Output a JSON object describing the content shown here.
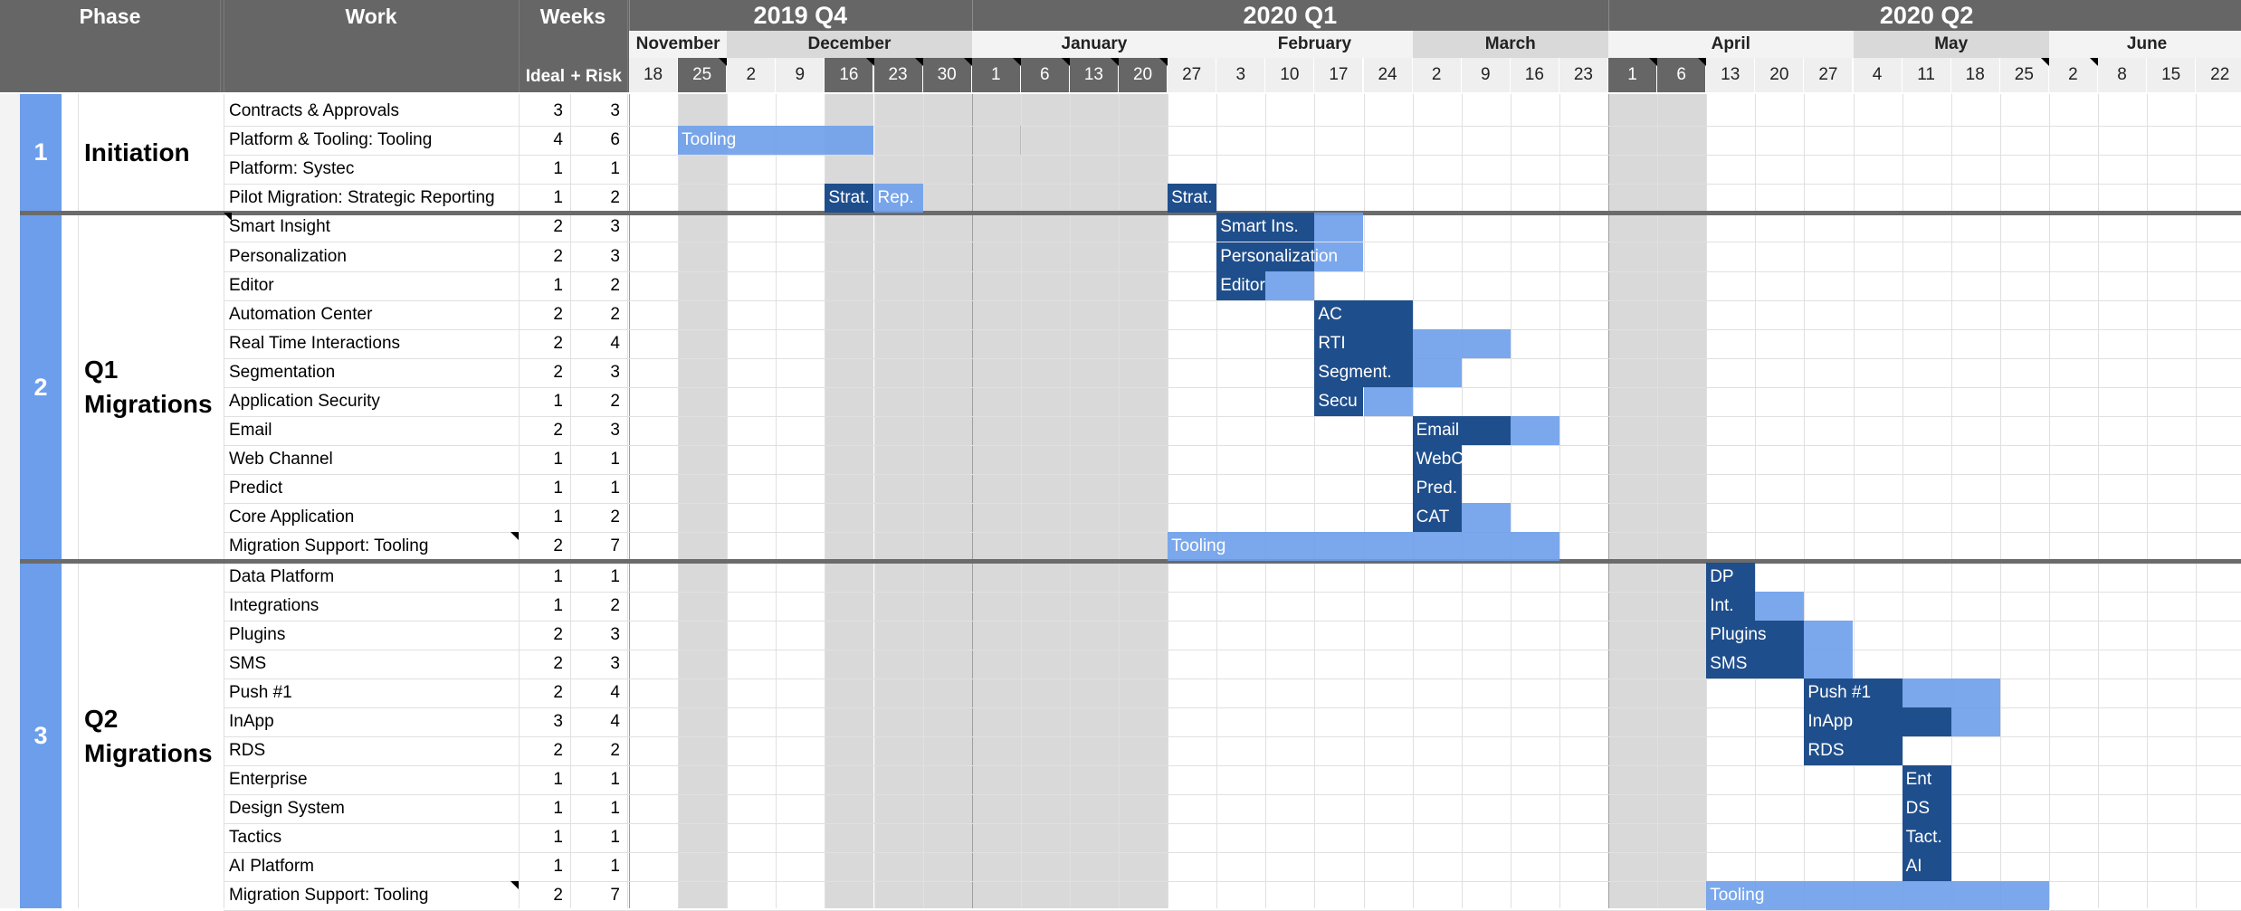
{
  "headers": {
    "phase": "Phase",
    "work": "Work",
    "weeks": "Weeks",
    "ideal": "Ideal",
    "risk": "+ Risk"
  },
  "quarters": [
    "2019 Q4",
    "2020 Q1",
    "2020 Q2"
  ],
  "months": [
    "November",
    "December",
    "January",
    "February",
    "March",
    "April",
    "May",
    "June"
  ],
  "weeks": [
    "18",
    "25",
    "2",
    "9",
    "16",
    "23",
    "30",
    "1",
    "6",
    "13",
    "20",
    "27",
    "3",
    "10",
    "17",
    "24",
    "2",
    "9",
    "16",
    "23",
    "1",
    "6",
    "13",
    "20",
    "27",
    "4",
    "11",
    "18",
    "25",
    "2",
    "8",
    "15",
    "22"
  ],
  "highlighted_weeks": [
    "25",
    "16",
    "23",
    "30",
    "1",
    "6",
    "13",
    "20",
    "1",
    "6"
  ],
  "phases": [
    {
      "number": "1",
      "name": "Initiation"
    },
    {
      "number": "2",
      "name": "Q1\nMigrations"
    },
    {
      "number": "3",
      "name": "Q2\nMigrations"
    }
  ],
  "rows": [
    {
      "work": "Contracts & Approvals",
      "ideal": "3",
      "risk": "3"
    },
    {
      "work": "Platform & Tooling: Tooling",
      "ideal": "4",
      "risk": "6"
    },
    {
      "work": "Platform: Systec",
      "ideal": "1",
      "risk": "1"
    },
    {
      "work": "Pilot Migration: Strategic Reporting",
      "ideal": "1",
      "risk": "2"
    },
    {
      "work": "Smart Insight",
      "ideal": "2",
      "risk": "3"
    },
    {
      "work": "Personalization",
      "ideal": "2",
      "risk": "3"
    },
    {
      "work": "Editor",
      "ideal": "1",
      "risk": "2"
    },
    {
      "work": "Automation Center",
      "ideal": "2",
      "risk": "2"
    },
    {
      "work": "Real Time Interactions",
      "ideal": "2",
      "risk": "4"
    },
    {
      "work": "Segmentation",
      "ideal": "2",
      "risk": "3"
    },
    {
      "work": "Application Security",
      "ideal": "1",
      "risk": "2"
    },
    {
      "work": "Email",
      "ideal": "2",
      "risk": "3"
    },
    {
      "work": "Web Channel",
      "ideal": "1",
      "risk": "1"
    },
    {
      "work": "Predict",
      "ideal": "1",
      "risk": "1"
    },
    {
      "work": "Core Application",
      "ideal": "1",
      "risk": "2"
    },
    {
      "work": "Migration Support: Tooling",
      "ideal": "2",
      "risk": "7"
    },
    {
      "work": "Data Platform",
      "ideal": "1",
      "risk": "1"
    },
    {
      "work": "Integrations",
      "ideal": "1",
      "risk": "2"
    },
    {
      "work": "Plugins",
      "ideal": "2",
      "risk": "3"
    },
    {
      "work": "SMS",
      "ideal": "2",
      "risk": "3"
    },
    {
      "work": "Push #1",
      "ideal": "2",
      "risk": "4"
    },
    {
      "work": "InApp",
      "ideal": "3",
      "risk": "4"
    },
    {
      "work": "RDS",
      "ideal": "2",
      "risk": "2"
    },
    {
      "work": "Enterprise",
      "ideal": "1",
      "risk": "1"
    },
    {
      "work": "Design System",
      "ideal": "1",
      "risk": "1"
    },
    {
      "work": "Tactics",
      "ideal": "1",
      "risk": "1"
    },
    {
      "work": "AI Platform",
      "ideal": "1",
      "risk": "1"
    },
    {
      "work": "Migration Support: Tooling",
      "ideal": "2",
      "risk": "7"
    }
  ],
  "bars": [
    {
      "row": 1,
      "start_week": "25",
      "ideal_weeks": 0,
      "risk_weeks": 4,
      "label": "Tooling"
    },
    {
      "row": 3,
      "start_week": "16",
      "ideal_weeks": 1,
      "risk_weeks": 1,
      "label": "Strat.",
      "extra_label": "Rep."
    },
    {
      "row": 3,
      "start_week": "27",
      "ideal_weeks": 1,
      "risk_weeks": 0,
      "label": "Strat."
    },
    {
      "row": 4,
      "start_week": "3",
      "ideal_weeks": 2,
      "risk_weeks": 1,
      "label": "Smart Ins."
    },
    {
      "row": 5,
      "start_week": "3",
      "ideal_weeks": 2,
      "risk_weeks": 1,
      "label": "Personalization",
      "label_on_light": true
    },
    {
      "row": 6,
      "start_week": "3",
      "ideal_weeks": 1,
      "risk_weeks": 1,
      "label": "Editor"
    },
    {
      "row": 7,
      "start_week": "17",
      "ideal_weeks": 2,
      "risk_weeks": 0,
      "label": "AC"
    },
    {
      "row": 8,
      "start_week": "17",
      "ideal_weeks": 2,
      "risk_weeks": 2,
      "label": "RTI"
    },
    {
      "row": 9,
      "start_week": "17",
      "ideal_weeks": 2,
      "risk_weeks": 1,
      "label": "Segment."
    },
    {
      "row": 10,
      "start_week": "17",
      "ideal_weeks": 1,
      "risk_weeks": 1,
      "label": "Secu"
    },
    {
      "row": 11,
      "start_week": "2",
      "ideal_weeks": 2,
      "risk_weeks": 1,
      "label": "Email"
    },
    {
      "row": 12,
      "start_week": "2",
      "ideal_weeks": 1,
      "risk_weeks": 0,
      "label": "WebC"
    },
    {
      "row": 13,
      "start_week": "2",
      "ideal_weeks": 1,
      "risk_weeks": 0,
      "label": "Pred."
    },
    {
      "row": 14,
      "start_week": "2",
      "ideal_weeks": 1,
      "risk_weeks": 1,
      "label": "CAT"
    },
    {
      "row": 15,
      "start_week": "27",
      "ideal_weeks": 0,
      "risk_weeks": 8,
      "label": "Tooling"
    },
    {
      "row": 16,
      "start_week": "13",
      "ideal_weeks": 1,
      "risk_weeks": 0,
      "label": "DP"
    },
    {
      "row": 17,
      "start_week": "13",
      "ideal_weeks": 1,
      "risk_weeks": 1,
      "label": "Int."
    },
    {
      "row": 18,
      "start_week": "13",
      "ideal_weeks": 2,
      "risk_weeks": 1,
      "label": "Plugins"
    },
    {
      "row": 19,
      "start_week": "13",
      "ideal_weeks": 2,
      "risk_weeks": 1,
      "label": "SMS"
    },
    {
      "row": 20,
      "start_week": "27",
      "ideal_weeks": 2,
      "risk_weeks": 2,
      "label": "Push #1"
    },
    {
      "row": 21,
      "start_week": "27",
      "ideal_weeks": 3,
      "risk_weeks": 1,
      "label": "InApp"
    },
    {
      "row": 22,
      "start_week": "27",
      "ideal_weeks": 2,
      "risk_weeks": 0,
      "label": "RDS"
    },
    {
      "row": 23,
      "start_week": "11",
      "ideal_weeks": 1,
      "risk_weeks": 0,
      "label": "Ent"
    },
    {
      "row": 24,
      "start_week": "11",
      "ideal_weeks": 1,
      "risk_weeks": 0,
      "label": "DS"
    },
    {
      "row": 25,
      "start_week": "11",
      "ideal_weeks": 1,
      "risk_weeks": 0,
      "label": "Tact."
    },
    {
      "row": 26,
      "start_week": "11",
      "ideal_weeks": 1,
      "risk_weeks": 0,
      "label": "AI"
    },
    {
      "row": 27,
      "start_week": "13",
      "ideal_weeks": 0,
      "risk_weeks": 7,
      "label": "Tooling"
    }
  ],
  "colors": {
    "header_bg": "#666666",
    "ideal_bar": "#1f4e8c",
    "risk_bar": "#6d9eeb",
    "phase_band": "#6d9eeb",
    "holiday_shade": "#d9d9d9"
  }
}
